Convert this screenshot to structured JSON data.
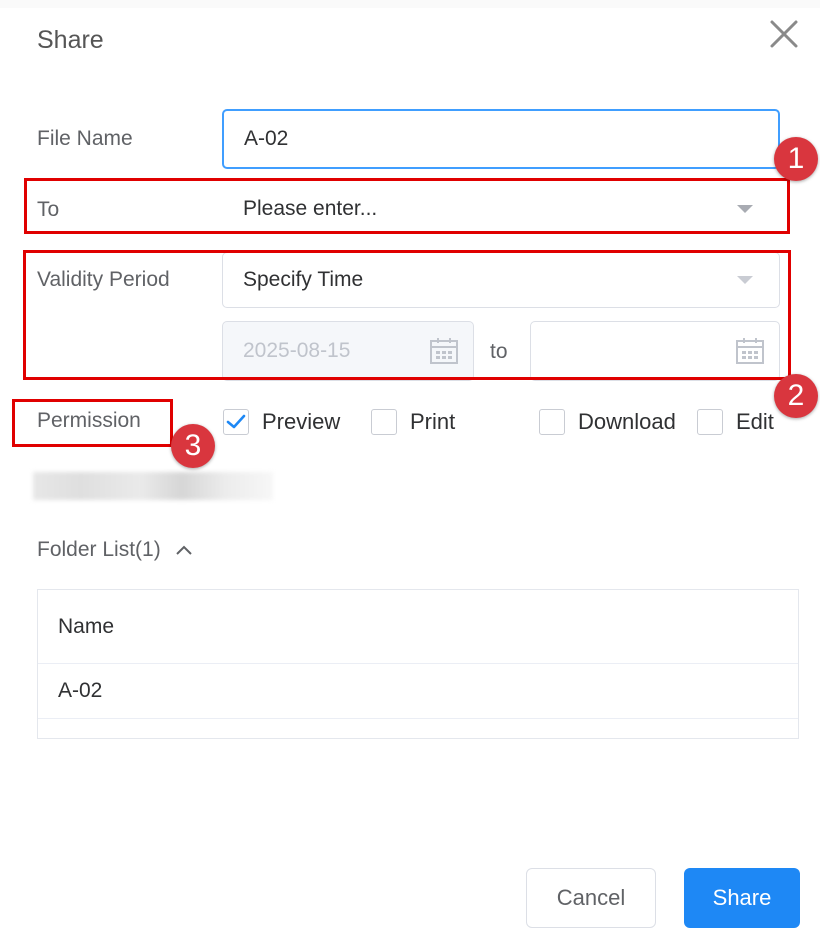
{
  "dialog": {
    "title": "Share"
  },
  "form": {
    "file_name": {
      "label": "File Name",
      "value": "A-02"
    },
    "to": {
      "label": "To",
      "placeholder": "Please enter..."
    },
    "validity": {
      "label": "Validity Period",
      "selected": "Specify Time",
      "start_date": "2025-08-15",
      "range_separator": "to",
      "end_date": ""
    },
    "permission": {
      "label": "Permission",
      "options": [
        {
          "label": "Preview",
          "checked": true
        },
        {
          "label": "Print",
          "checked": false
        },
        {
          "label": "Download",
          "checked": false
        },
        {
          "label": "Edit",
          "checked": false
        }
      ]
    }
  },
  "folder_list": {
    "label": "Folder List(1)",
    "columns": [
      "Name"
    ],
    "rows": [
      [
        "A-02"
      ]
    ]
  },
  "footer": {
    "cancel_label": "Cancel",
    "share_label": "Share"
  },
  "annotations": {
    "badges": [
      "1",
      "2",
      "3"
    ],
    "color": "#e00000",
    "badge_color": "#d9363e"
  },
  "colors": {
    "primary": "#1e88f5",
    "focus_border": "#409eff"
  }
}
